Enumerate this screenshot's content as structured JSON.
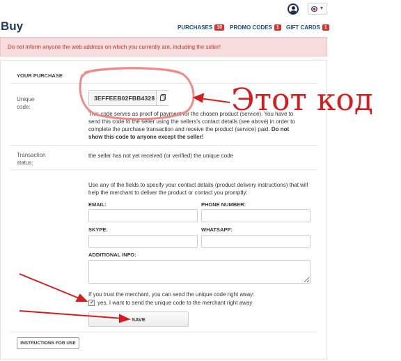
{
  "page": {
    "title": "Buy"
  },
  "header": {
    "icons": [
      "user-icon",
      "uk-flag-icon",
      "caret-down-icon"
    ]
  },
  "nav": {
    "purchases": {
      "label": "PURCHASES",
      "count": "10"
    },
    "promo_codes": {
      "label": "PROMO CODES",
      "count": "1"
    },
    "gift_cards": {
      "label": "GIFT CARDS",
      "count": "1"
    }
  },
  "warning": {
    "text": "Do not inform anyone the web address on which you currently are, including the seller!"
  },
  "purchase": {
    "section_title": "YOUR PURCHASE",
    "code_label_line1": "Unique",
    "code_label_line2": "code:",
    "code": "3EFFEEB02FBB4328",
    "code_desc": "This code serves as proof of payment for the chosen product (service). You have to send this code to the seller using the sellers's contact details (see above) in order to complete the purchase transaction and receive the product (service) paid.",
    "code_desc_bold": "Do not show this code to anyone except the seller!",
    "status_label_line1": "Transaction",
    "status_label_line2": "status:",
    "status_value": "the seller has not yet received (or verified) the unique code"
  },
  "contact": {
    "intro": "Use any of the fields to specify your contact details (product delivery instructions) that will help the merchant to deliver the product or contact you promptly:",
    "email_label": "EMAIL:",
    "phone_label": "PHONE NUMBER:",
    "skype_label": "SKYPE:",
    "whatsapp_label": "WHATSAPP:",
    "info_label": "ADDITIONAL INFO:",
    "email_value": "",
    "phone_value": "",
    "skype_value": "",
    "whatsapp_value": "",
    "info_value": ""
  },
  "trust": {
    "text": "If you trust the merchant, you can send the unique code right away:",
    "checkbox_label": "yes, I want to send the unique code to the merchant right away",
    "checked": true
  },
  "buttons": {
    "save": "SAVE",
    "instructions": "INSTRUCTIONS FOR USE"
  },
  "annotation": {
    "text": "Этот код",
    "color": "#d51d20"
  }
}
